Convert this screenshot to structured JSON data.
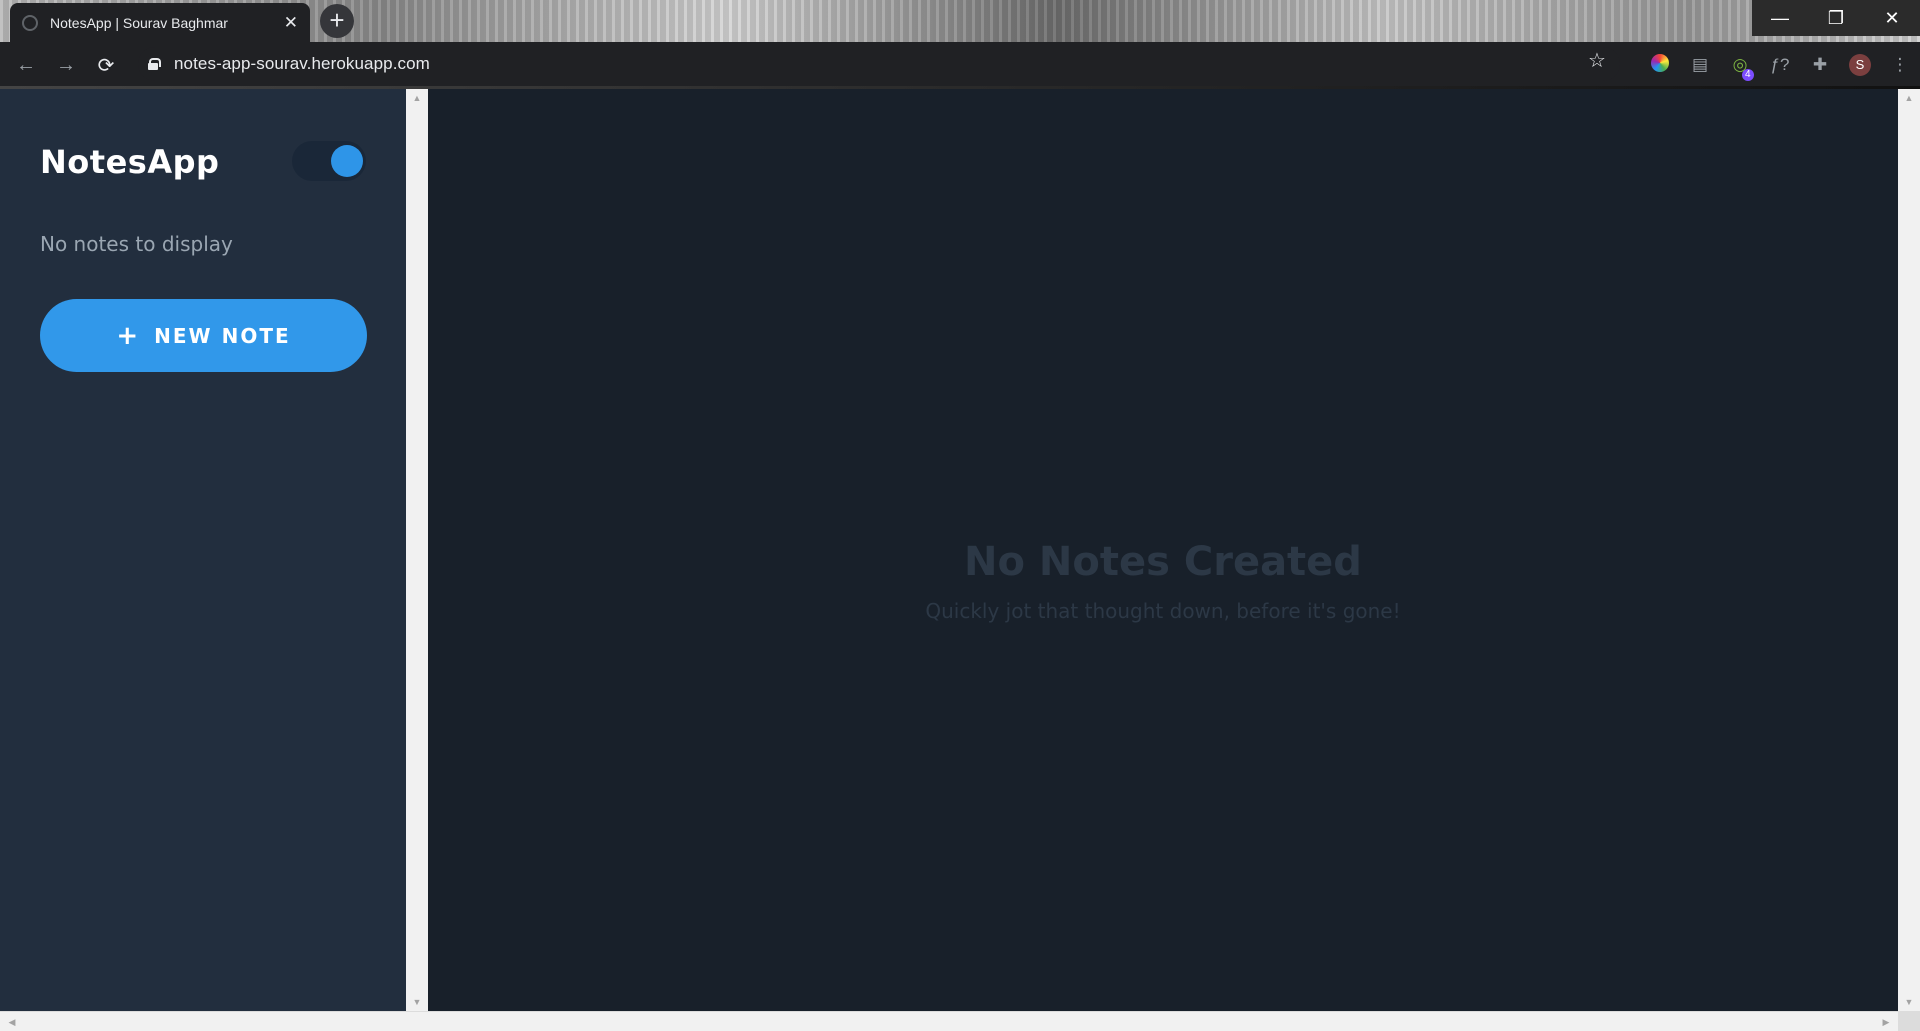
{
  "browser": {
    "tab_title": "NotesApp | Sourav Baghmar",
    "tab_close": "✕",
    "new_tab": "+",
    "url": "notes-app-sourav.herokuapp.com",
    "back": "←",
    "forward": "→",
    "reload": "⟳",
    "star": "☆",
    "window_controls": {
      "minimize": "—",
      "maximize": "❐",
      "close": "✕"
    },
    "extension_badge": "4",
    "profile_initial": "S"
  },
  "sidebar": {
    "app_title": "NotesApp",
    "theme_toggle_on": true,
    "empty_text": "No notes to display",
    "new_note_label": "NEW NOTE",
    "new_note_icon": "+"
  },
  "main": {
    "heading": "No Notes Created",
    "subtext": "Quickly jot that thought down, before it's gone!"
  },
  "colors": {
    "sidebar_bg": "#222e3e",
    "main_bg": "#18202a",
    "accent": "#3198ea",
    "empty_text": "#2c3846"
  }
}
